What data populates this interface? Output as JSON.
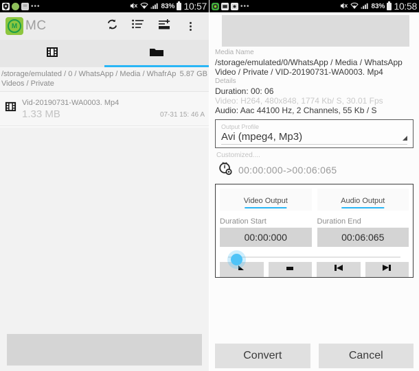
{
  "left": {
    "statusbar": {
      "icons": [
        "shield-icon",
        "update-icon",
        "document-icon",
        "more-dots"
      ],
      "mute": "mute-icon",
      "wifi": "wifi-icon",
      "signal": "signal-icon",
      "battery_pct": "83%",
      "time": "10:57"
    },
    "appbar": {
      "logo_text": "M",
      "brand": "MC",
      "buttons": [
        "refresh-icon",
        "list-icon",
        "add-to-list-icon",
        "overflow-menu-icon"
      ]
    },
    "tabs": [
      {
        "name": "video-tab",
        "icon": "film-strip-icon",
        "active": false
      },
      {
        "name": "folder-tab",
        "icon": "folder-icon",
        "active": true
      }
    ],
    "path": {
      "line1": "/storage/emulated / 0 / WhatsApp / Media / WhafrAp",
      "size": "5.87 GB",
      "line2": "Videos / Private"
    },
    "file": {
      "icon": "film-strip-icon",
      "name": "Vid-20190731-WA0003. Mp4",
      "size": "1.33 MB",
      "date": "07-31 15: 46 A"
    },
    "ad_banner": "ad-placeholder"
  },
  "right": {
    "statusbar": {
      "battery_pct": "83%",
      "time": "10:58"
    },
    "preview": "video-preview-placeholder",
    "media": {
      "name_label": "Media Name",
      "path_line1": "/storage/emulated/0/WhatsApp / Media / WhatsApp",
      "path_line2": "Video / Private / VID-20190731-WA0003. Mp4",
      "details_label": "Details",
      "duration": "Duration: 00: 06",
      "video": "Video: H264, 480x848, 1774 Kb/ S, 30.01 Fps",
      "audio": "Audio: Aac 44100 Hz, 2 Channels, 55 Kb / S"
    },
    "profile": {
      "label": "Output Profile",
      "value": "Avi (mpeg4, Mp3)",
      "caret": "chevron-down-icon"
    },
    "customized": "Customized....",
    "trim": {
      "icon": "timer-icon",
      "range": "00:00:000->00:06:065"
    },
    "output_tabs": [
      {
        "label": "Video Output",
        "name": "video-output-tab"
      },
      {
        "label": "Audio Output",
        "name": "audio-output-tab"
      }
    ],
    "duration": {
      "start_label": "Duration Start",
      "start_value": "00:00:000",
      "end_label": "Duration End",
      "end_value": "00:06:065"
    },
    "transport": [
      {
        "name": "play-button",
        "icon": "play-icon"
      },
      {
        "name": "stop-button",
        "icon": "stop-icon"
      },
      {
        "name": "mark-in-button",
        "icon": "mark-in-icon"
      },
      {
        "name": "mark-out-button",
        "icon": "mark-out-icon"
      }
    ],
    "actions": {
      "convert": "Convert",
      "cancel": "Cancel"
    }
  },
  "colors": {
    "accent": "#29b6f6",
    "thumb": "#4fc3f7",
    "logo_green": "#8dc63f"
  }
}
